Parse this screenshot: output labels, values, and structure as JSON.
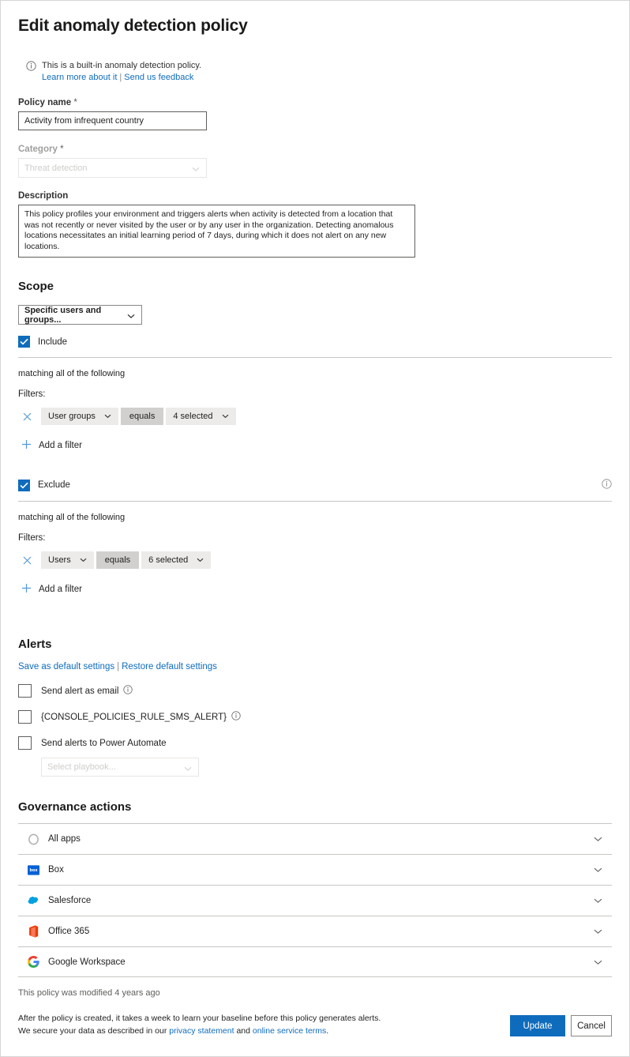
{
  "header": {
    "title": "Edit anomaly detection policy",
    "notice_icon": "info-icon",
    "notice_text": "This is a built-in anomaly detection policy.",
    "link_learn_more": "Learn more about it",
    "link_separator": "|",
    "link_feedback": "Send us feedback"
  },
  "policy_name": {
    "label": "Policy name",
    "required_marker": "*",
    "value": "Activity from infrequent country"
  },
  "category": {
    "label": "Category",
    "required_marker": "*",
    "value": "Threat detection",
    "chevron_icon": "chevron-down-icon"
  },
  "description": {
    "label": "Description",
    "value": "This policy profiles your environment and triggers alerts when activity is detected from a location that was not recently or never visited by the user or by any user in the organization. Detecting anomalous locations necessitates an initial learning period of 7 days, during which it does not alert on any new locations."
  },
  "scope": {
    "heading": "Scope",
    "selector_value": "Specific users and groups...",
    "selector_chevron": "chevron-down-icon",
    "include": {
      "label": "Include",
      "checked": true,
      "matching_text": "matching all of the following",
      "filters_label": "Filters:",
      "filters": [
        {
          "remove_icon": "close-icon",
          "attribute": "User groups",
          "attribute_chevron": "chevron-down-icon",
          "operator": "equals",
          "value": "4 selected",
          "value_chevron": "chevron-down-icon"
        }
      ],
      "add_filter_label": "Add a filter",
      "add_filter_icon": "plus-icon"
    },
    "exclude": {
      "label": "Exclude",
      "checked": true,
      "info_icon": "info-icon",
      "matching_text": "matching all of the following",
      "filters_label": "Filters:",
      "filters": [
        {
          "remove_icon": "close-icon",
          "attribute": "Users",
          "attribute_chevron": "chevron-down-icon",
          "operator": "equals",
          "value": "6 selected",
          "value_chevron": "chevron-down-icon"
        }
      ],
      "add_filter_label": "Add a filter",
      "add_filter_icon": "plus-icon"
    }
  },
  "alerts": {
    "heading": "Alerts",
    "save_default_link": "Save as default settings",
    "link_separator": "|",
    "restore_default_link": "Restore default settings",
    "options": [
      {
        "label": "Send alert as email",
        "checked": false,
        "info_icon": "info-icon"
      },
      {
        "label": "{CONSOLE_POLICIES_RULE_SMS_ALERT}",
        "checked": false,
        "info_icon": "info-icon"
      },
      {
        "label": "Send alerts to Power Automate",
        "checked": false,
        "info_icon": null
      }
    ],
    "playbook": {
      "placeholder": "Select playbook...",
      "chevron_icon": "chevron-down-icon"
    }
  },
  "governance": {
    "heading": "Governance actions",
    "rows": [
      {
        "label": "All apps",
        "icon": "all-apps-icon",
        "chevron_icon": "chevron-down-icon"
      },
      {
        "label": "Box",
        "icon": "box-icon",
        "chevron_icon": "chevron-down-icon"
      },
      {
        "label": "Salesforce",
        "icon": "salesforce-icon",
        "chevron_icon": "chevron-down-icon"
      },
      {
        "label": "Office 365",
        "icon": "office365-icon",
        "chevron_icon": "chevron-down-icon"
      },
      {
        "label": "Google Workspace",
        "icon": "google-workspace-icon",
        "chevron_icon": "chevron-down-icon"
      }
    ]
  },
  "footer": {
    "modified_text": "This policy was modified 4 years ago",
    "note_line1": "After the policy is created, it takes a week to learn your baseline before this policy generates alerts.",
    "note_line2_prefix": "We secure your data as described in our ",
    "note_link_privacy": "privacy statement",
    "note_line2_mid": " and ",
    "note_link_terms": "online service terms",
    "note_line2_suffix": ".",
    "update_button": "Update",
    "cancel_button": "Cancel"
  },
  "colors": {
    "accent": "#0f6cbd",
    "link": "#0f6cbd",
    "pill_bg": "#edebe9",
    "pill_operator_bg": "#d2d0ce",
    "border": "#c8c6c4",
    "text": "#201f1e",
    "muted": "#a19f9d"
  }
}
